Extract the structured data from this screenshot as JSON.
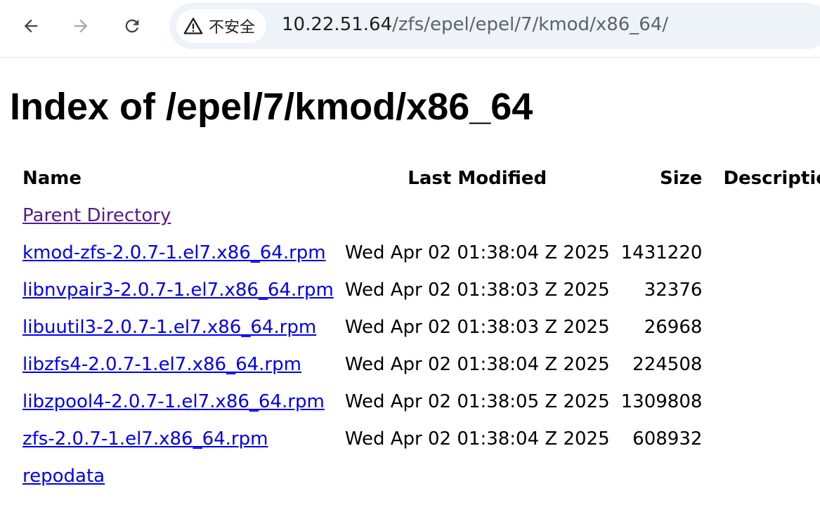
{
  "browser": {
    "security_label": "不安全",
    "url_host": "10.22.51.64",
    "url_path": "/zfs/epel/epel/7/kmod/x86_64/"
  },
  "page": {
    "title": "Index of /epel/7/kmod/x86_64",
    "columns": {
      "name": "Name",
      "last_modified": "Last Modified",
      "size": "Size",
      "description": "Description"
    },
    "parent_link": "Parent Directory",
    "rows": [
      {
        "name": "kmod-zfs-2.0.7-1.el7.x86_64.rpm",
        "modified": "Wed Apr 02 01:38:04 Z 2025",
        "size": "1431220"
      },
      {
        "name": "libnvpair3-2.0.7-1.el7.x86_64.rpm",
        "modified": "Wed Apr 02 01:38:03 Z 2025",
        "size": "32376"
      },
      {
        "name": "libuutil3-2.0.7-1.el7.x86_64.rpm",
        "modified": "Wed Apr 02 01:38:03 Z 2025",
        "size": "26968"
      },
      {
        "name": "libzfs4-2.0.7-1.el7.x86_64.rpm",
        "modified": "Wed Apr 02 01:38:04 Z 2025",
        "size": "224508"
      },
      {
        "name": "libzpool4-2.0.7-1.el7.x86_64.rpm",
        "modified": "Wed Apr 02 01:38:05 Z 2025",
        "size": "1309808"
      },
      {
        "name": "zfs-2.0.7-1.el7.x86_64.rpm",
        "modified": "Wed Apr 02 01:38:04 Z 2025",
        "size": "608932"
      }
    ],
    "last_link": "repodata"
  },
  "colors": {
    "link": "#0000ee",
    "visited_link": "#551a8b",
    "omnibox_bg": "#eef2f9"
  },
  "icons": [
    "back-arrow-icon",
    "forward-arrow-icon",
    "reload-icon",
    "warning-triangle-icon"
  ]
}
